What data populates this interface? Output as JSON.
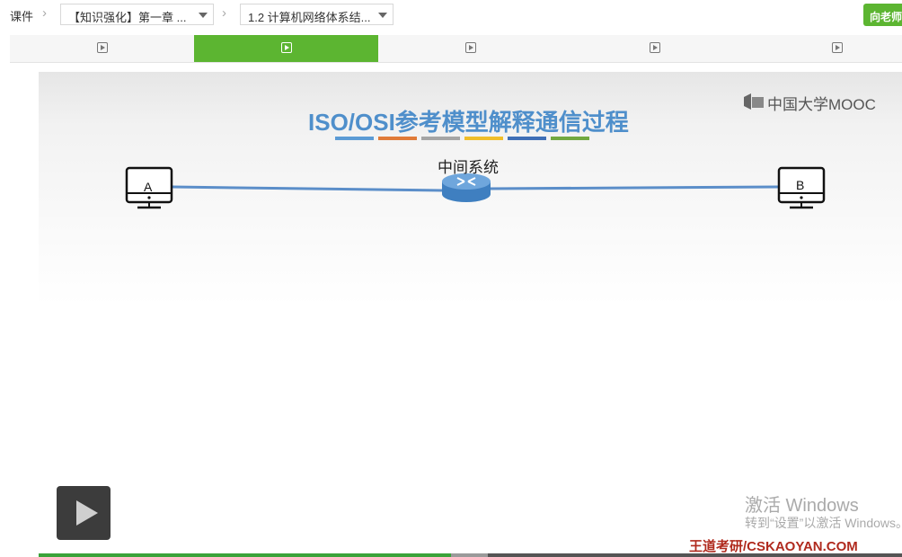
{
  "breadcrumb": {
    "root": "课件",
    "chapter_select": "【知识强化】第一章 ...",
    "section_select": "1.2 计算机网络体系结..."
  },
  "teacher_button": "向老师",
  "tabs": [
    {
      "icon": "play-icon",
      "active": false
    },
    {
      "icon": "play-icon",
      "active": true
    },
    {
      "icon": "play-icon",
      "active": false
    },
    {
      "icon": "play-icon",
      "active": false
    },
    {
      "icon": "play-icon",
      "active": false
    }
  ],
  "slide": {
    "title": "ISO/OSI参考模型解释通信过程",
    "title_bar_colors": [
      "#5b9bd5",
      "#e07b39",
      "#a5a5a5",
      "#f0be2a",
      "#3f6fb6",
      "#71a840"
    ],
    "logo_text": "中国大学MOOC",
    "host_a_label": "A",
    "host_b_label": "B",
    "middle_label": "中间系统",
    "line_color": "#5b8ec9"
  },
  "watermark": {
    "title": "激活 Windows",
    "subtitle": "转到“设置”以激活 Windows。"
  },
  "brand_text": "王道考研/CSKAOYAN.COM",
  "progress": {
    "played_fraction": 0.478,
    "buffered_fraction": 0.52
  },
  "colors": {
    "accent": "#5cb531",
    "progress": "#3aa33a"
  }
}
